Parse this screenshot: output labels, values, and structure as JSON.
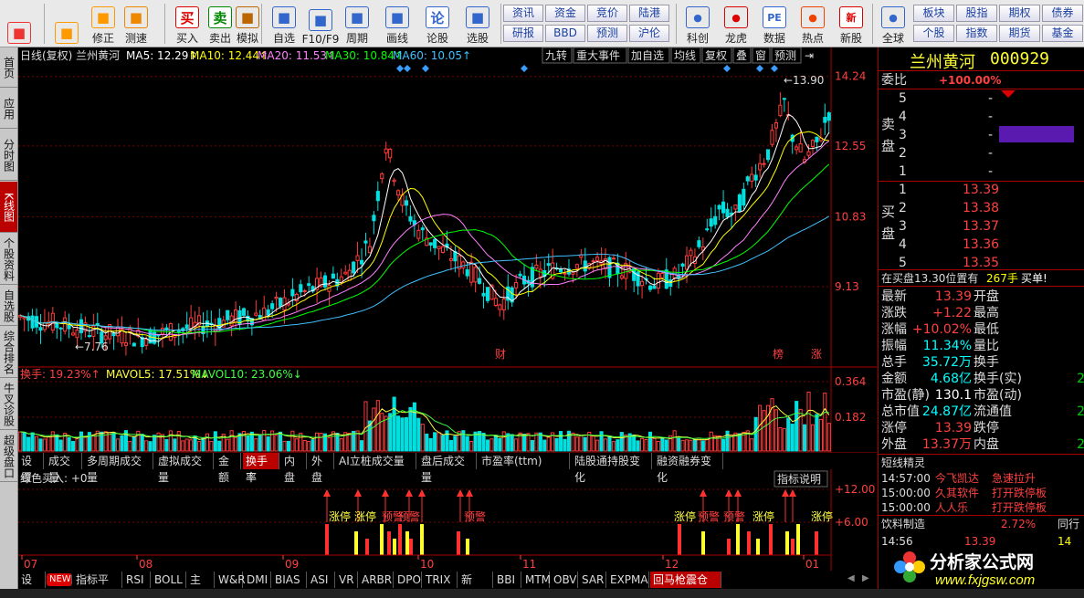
{
  "toolbar": {
    "buttons": [
      {
        "label": "",
        "icon": "window-icon",
        "color": "#e33"
      },
      {
        "label": "",
        "icon": "back-arrow-icon",
        "color": "#f90"
      },
      {
        "label": "修正",
        "icon": "up-down-arrows-icon",
        "color": "#f90"
      },
      {
        "label": "测速",
        "icon": "clock-icon",
        "color": "#e80"
      },
      {
        "label": "买入",
        "icon": "buy-icon",
        "glyph": "买",
        "color": "#d00"
      },
      {
        "label": "卖出",
        "icon": "sell-icon",
        "glyph": "卖",
        "color": "#080"
      },
      {
        "label": "模拟",
        "icon": "hammer-icon",
        "color": "#b60"
      },
      {
        "label": "自选",
        "icon": "star-icon",
        "color": "#36c"
      },
      {
        "label": "F10/F9",
        "icon": "f10-icon",
        "color": "#36c"
      },
      {
        "label": "周期",
        "icon": "cycle-icon",
        "color": "#36c"
      },
      {
        "label": "画线",
        "icon": "pencil-icon",
        "color": "#36c"
      },
      {
        "label": "论股",
        "icon": "discuss-icon",
        "glyph": "论",
        "color": "#36c"
      },
      {
        "label": "选股",
        "icon": "magnifier-icon",
        "color": "#36c"
      }
    ],
    "panel_buttons_row1": [
      "资讯",
      "资金",
      "竞价",
      "陆港"
    ],
    "panel_buttons_row2": [
      "研报",
      "BBD",
      "预测",
      "沪伦"
    ],
    "buttons2": [
      {
        "label": "科创",
        "icon": "chart-icon",
        "color": "#36c"
      },
      {
        "label": "龙虎",
        "icon": "dragon-icon",
        "color": "#d00"
      },
      {
        "label": "数据",
        "icon": "pe-icon",
        "glyph": "PE",
        "color": "#36c"
      },
      {
        "label": "热点",
        "icon": "fire-icon",
        "color": "#e40"
      },
      {
        "label": "新股",
        "icon": "new-stock-icon",
        "glyph": "新",
        "color": "#d00"
      },
      {
        "label": "全球",
        "icon": "globe-icon",
        "color": "#36c"
      }
    ],
    "right_row1": [
      "板块",
      "股指",
      "期权",
      "债券"
    ],
    "right_row2": [
      "个股",
      "指数",
      "期货",
      "基金"
    ]
  },
  "left_tabs": [
    "首页",
    "应用",
    "分时图",
    "K线图",
    "个股资料",
    "自选股",
    "综合排名",
    "牛叉诊股",
    "超级盘口"
  ],
  "chart_header": {
    "title": "日线(复权) 兰州黄河",
    "ma5": "MA5: 12.29↑",
    "ma10": "MA10: 12.44↑",
    "ma20": "MA20: 11.53↑",
    "ma30": "MA30: 10.84↑",
    "ma60": "MA60: 10.05↑",
    "buttons": [
      "九转",
      "重大事件",
      "加自选",
      "均线",
      "复权",
      "叠",
      "窗",
      "预测"
    ],
    "colors": {
      "ma5": "#ffffff",
      "ma10": "#ffff00",
      "ma20": "#ff80ff",
      "ma30": "#00ff00",
      "ma60": "#40c0ff"
    }
  },
  "chart_data": {
    "type": "candlestick",
    "y_ticks": [
      "14.24",
      "12.55",
      "10.83",
      "9.13"
    ],
    "x_ticks": [
      "07",
      "08",
      "09",
      "10",
      "11",
      "12",
      "01"
    ],
    "annotations": [
      "13.90",
      "7.76",
      "财",
      "榜",
      "涨"
    ],
    "volume_header": {
      "hs": "换手: 19.23%↑",
      "mavol5": "MAVOL5: 17.51%↓",
      "mavol10": "MAVOL10: 23.06%↓"
    },
    "volume_ticks": [
      "0.364",
      "0.182"
    ],
    "indicator_header": "绿色买入: +0",
    "indicator_ticks": [
      "+12.00",
      "+6.00"
    ],
    "indicator_button": "指标说明",
    "signal_labels": [
      "涨停",
      "预警"
    ]
  },
  "mid_tabs": [
    "设置",
    "成交量",
    "多周期成交量",
    "虚拟成交量",
    "金额",
    "换手率",
    "内盘",
    "外盘",
    "AI立桩成交量",
    "盘后成交量",
    "市盈率(ttm)",
    "陆股通持股变化",
    "融资融券变化"
  ],
  "mid_tab_active": "换手率",
  "bottom_tabs": [
    "设置",
    "NEW",
    "指标平台",
    "RSI",
    "BOLL",
    "主力",
    "W&R",
    "DMI",
    "BIAS",
    "ASI",
    "VR",
    "ARBR",
    "DPO",
    "TRIX",
    "新DMA",
    "BBI",
    "MTM",
    "OBV",
    "SAR",
    "EXPMA",
    "回马枪震仓线"
  ],
  "side": {
    "name": "兰州黄河",
    "code": "000929",
    "weibi_label": "委比",
    "weibi": "+100.00%",
    "sell_label": "卖盘",
    "buy_label": "买盘",
    "sell": [
      {
        "lvl": "5",
        "price": "-",
        "vol": ""
      },
      {
        "lvl": "4",
        "price": "-",
        "vol": ""
      },
      {
        "lvl": "3",
        "price": "-",
        "vol": ""
      },
      {
        "lvl": "2",
        "price": "-",
        "vol": ""
      },
      {
        "lvl": "1",
        "price": "-",
        "vol": ""
      }
    ],
    "buy": [
      {
        "lvl": "1",
        "price": "13.39"
      },
      {
        "lvl": "2",
        "price": "13.38"
      },
      {
        "lvl": "3",
        "price": "13.37"
      },
      {
        "lvl": "4",
        "price": "13.36"
      },
      {
        "lvl": "5",
        "price": "13.35"
      }
    ],
    "notice": "在买盘13.30位置有",
    "notice_vol": "267手",
    "notice_act": "买单!",
    "stats": [
      {
        "l": "最新",
        "v": "13.39",
        "c": "red",
        "l2": "开盘",
        "v2": ""
      },
      {
        "l": "涨跌",
        "v": "+1.22",
        "c": "red",
        "l2": "最高",
        "v2": ""
      },
      {
        "l": "涨幅",
        "v": "+10.02%",
        "c": "red",
        "l2": "最低",
        "v2": ""
      },
      {
        "l": "振幅",
        "v": "11.34%",
        "c": "cyn",
        "l2": "量比",
        "v2": ""
      },
      {
        "l": "总手",
        "v": "35.72万",
        "c": "cyn",
        "l2": "换手",
        "v2": ""
      },
      {
        "l": "金额",
        "v": "4.68亿",
        "c": "cyn",
        "l2": "换手(实)",
        "v2": "2"
      },
      {
        "l": "市盈(静)",
        "v": "130.1",
        "c": "wht",
        "l2": "市盈(动)",
        "v2": ""
      },
      {
        "l": "总市值",
        "v": "24.87亿",
        "c": "cyn",
        "l2": "流通值",
        "v2": "2"
      },
      {
        "l": "涨停",
        "v": "13.39",
        "c": "red",
        "l2": "跌停",
        "v2": ""
      },
      {
        "l": "外盘",
        "v": "13.37万",
        "c": "red",
        "l2": "内盘",
        "v2": "2"
      }
    ],
    "news_title": "短线精灵",
    "news": [
      {
        "t": "14:57:00",
        "n": "今飞凯达",
        "e": "急速拉升"
      },
      {
        "t": "15:00:00",
        "n": "久其软件",
        "e": "打开跌停板"
      },
      {
        "t": "15:00:00",
        "n": "人人乐",
        "e": "打开跌停板"
      }
    ],
    "sector": "饮料制造",
    "sector_pct": "2.72%",
    "sector_btn": "同行",
    "tick_time": "14:56",
    "tick_price": "13.39",
    "tick_vol": "14",
    "logo_text": "分析家公式网",
    "logo_url": "www.fxjgsw.com"
  }
}
